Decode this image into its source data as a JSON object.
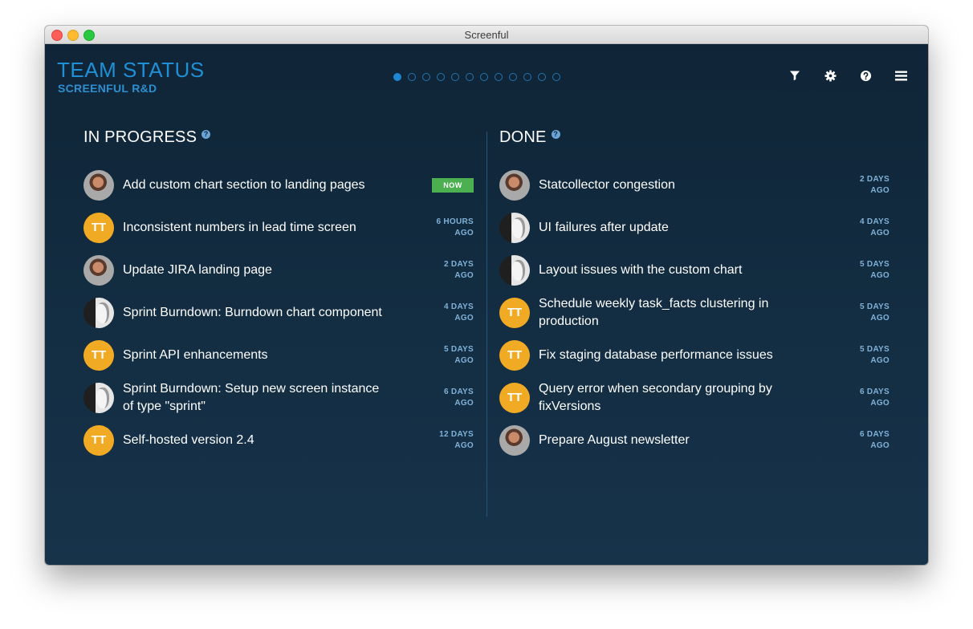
{
  "window": {
    "title": "Screenful"
  },
  "header": {
    "title": "TEAM STATUS",
    "subtitle": "SCREENFUL R&D",
    "pager": {
      "count": 12,
      "active": 0
    },
    "toolbar": [
      {
        "name": "filter-icon"
      },
      {
        "name": "gear-icon"
      },
      {
        "name": "help-icon"
      },
      {
        "name": "menu-icon"
      }
    ]
  },
  "in_progress": {
    "title": "IN PROGRESS",
    "help": "?",
    "items": [
      {
        "avatar": "photo-a",
        "initials": "",
        "text": "Add custom chart section to landing pages",
        "time": "",
        "badge": "NOW"
      },
      {
        "avatar": "initials",
        "initials": "TT",
        "text": "Inconsistent numbers in lead time screen",
        "time": "6 HOURS AGO",
        "badge": ""
      },
      {
        "avatar": "photo-a",
        "initials": "",
        "text": "Update JIRA landing page",
        "time": "2 DAYS AGO",
        "badge": ""
      },
      {
        "avatar": "photo-b",
        "initials": "",
        "text": "Sprint Burndown: Burndown chart component",
        "time": "4 DAYS AGO",
        "badge": ""
      },
      {
        "avatar": "initials",
        "initials": "TT",
        "text": "Sprint API enhancements",
        "time": "5 DAYS AGO",
        "badge": ""
      },
      {
        "avatar": "photo-b",
        "initials": "",
        "text": "Sprint Burndown: Setup new screen instance of type \"sprint\"",
        "time": "6 DAYS AGO",
        "badge": ""
      },
      {
        "avatar": "initials",
        "initials": "TT",
        "text": "Self-hosted version 2.4",
        "time": "12 DAYS AGO",
        "badge": ""
      }
    ]
  },
  "done": {
    "title": "DONE",
    "help": "?",
    "items": [
      {
        "avatar": "photo-a",
        "initials": "",
        "text": "Statcollector congestion",
        "time": "2 DAYS AGO",
        "badge": ""
      },
      {
        "avatar": "photo-b",
        "initials": "",
        "text": "UI failures after update",
        "time": "4 DAYS AGO",
        "badge": ""
      },
      {
        "avatar": "photo-b",
        "initials": "",
        "text": "Layout issues with the custom chart",
        "time": "5 DAYS AGO",
        "badge": ""
      },
      {
        "avatar": "initials",
        "initials": "TT",
        "text": "Schedule weekly task_facts clustering in production",
        "time": "5 DAYS AGO",
        "badge": ""
      },
      {
        "avatar": "initials",
        "initials": "TT",
        "text": "Fix staging database performance issues",
        "time": "5 DAYS AGO",
        "badge": ""
      },
      {
        "avatar": "initials",
        "initials": "TT",
        "text": "Query error when secondary grouping by fixVersions",
        "time": "6 DAYS AGO",
        "badge": ""
      },
      {
        "avatar": "photo-a",
        "initials": "",
        "text": "Prepare August newsletter",
        "time": "6 DAYS AGO",
        "badge": ""
      }
    ]
  },
  "colors": {
    "accent": "#1f8fd6",
    "badge_now": "#4cb050",
    "avatar_initials": "#f1aa23",
    "time_text": "#7fb1d9"
  }
}
